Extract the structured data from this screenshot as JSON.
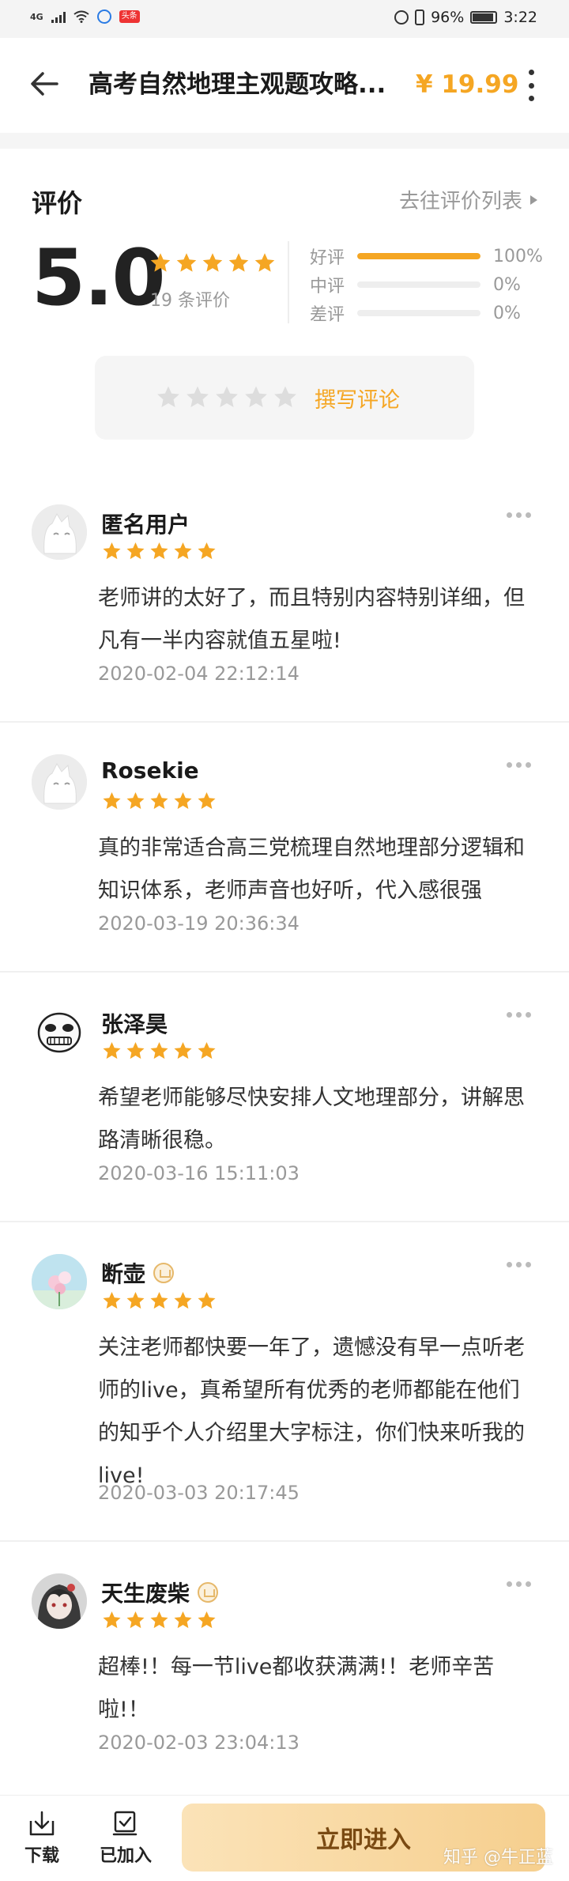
{
  "status_bar": {
    "network": "4G",
    "app_badge": "头条",
    "battery": "96%",
    "time": "3:22"
  },
  "header": {
    "title": "高考自然地理主观题攻略...",
    "price": "¥ 19.99"
  },
  "rating": {
    "section_title": "评价",
    "goto_list": "去往评价列表",
    "score": "5.0",
    "score_stars": 5,
    "count_text": "19 条评价",
    "distribution": [
      {
        "label": "好评",
        "percent_text": "100%",
        "fraction": 1.0
      },
      {
        "label": "中评",
        "percent_text": "0%",
        "fraction": 0
      },
      {
        "label": "差评",
        "percent_text": "0%",
        "fraction": 0
      }
    ],
    "write_review": "撰写评论"
  },
  "colors": {
    "accent": "#f5a623",
    "muted": "#999999",
    "star_empty": "#dddddd"
  },
  "reviews": [
    {
      "user": "匿名用户",
      "vip": false,
      "stars": 5,
      "text": "老师讲的太好了，而且特别内容特别详细，但凡有一半内容就值五星啦!",
      "date": "2020-02-04 22:12:14",
      "avatar": "cat-avatar"
    },
    {
      "user": "Rosekie",
      "vip": false,
      "stars": 5,
      "text": "真的非常适合高三党梳理自然地理部分逻辑和知识体系，老师声音也好听，代入感很强",
      "date": "2020-03-19 20:36:34",
      "avatar": "cat-avatar"
    },
    {
      "user": "张泽昊",
      "vip": false,
      "stars": 5,
      "text": "希望老师能够尽快安排人文地理部分，讲解思路清晰很稳。",
      "date": "2020-03-16 15:11:03",
      "avatar": "face-avatar"
    },
    {
      "user": "断壶",
      "vip": true,
      "stars": 5,
      "text": "关注老师都快要一年了，遗憾没有早一点听老师的live，真希望所有优秀的老师都能在他们的知乎个人介绍里大字标注，你们快来听我的live!",
      "date": "2020-03-03 20:17:45",
      "avatar": "flower-avatar"
    },
    {
      "user": "天生废柴",
      "vip": true,
      "stars": 5,
      "text": "超棒!！每一节live都收获满满!！老师辛苦啦!！",
      "date": "2020-02-03 23:04:13",
      "avatar": "anime-avatar"
    }
  ],
  "bottom_bar": {
    "download": "下载",
    "added": "已加入",
    "enter": "立即进入",
    "watermark": "知乎 @牛正蓝"
  }
}
